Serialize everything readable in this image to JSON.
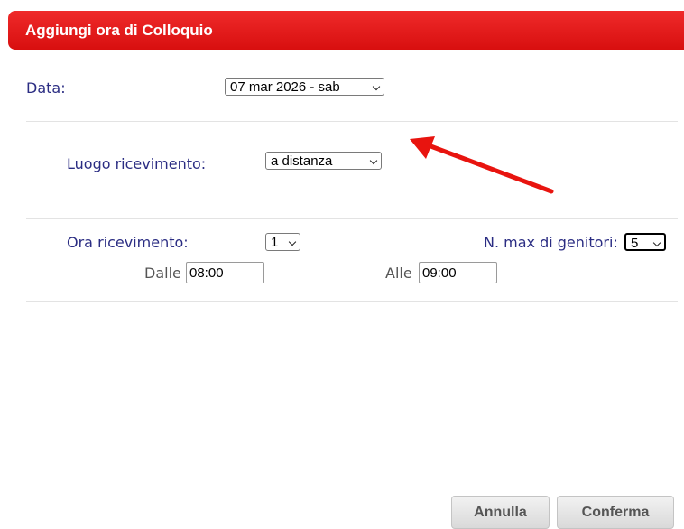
{
  "dialog": {
    "title": "Aggiungi ora di Colloquio"
  },
  "date": {
    "label": "Data:",
    "value": "07 mar 2026 - sab"
  },
  "location": {
    "label": "Luogo ricevimento:",
    "value": "a distanza"
  },
  "time": {
    "label": "Ora ricevimento:",
    "value": "1",
    "max_parents_label": "N. max di genitori:",
    "max_parents_value": "5",
    "from_label": "Dalle",
    "from_value": "08:00",
    "to_label": "Alle",
    "to_value": "09:00"
  },
  "buttons": {
    "cancel": "Annulla",
    "confirm": "Conferma"
  },
  "colors": {
    "header": "#e01b1b",
    "label": "#2b2d83",
    "arrow": "#e8140f"
  },
  "annotation": {
    "icon": "red-arrow-icon"
  }
}
